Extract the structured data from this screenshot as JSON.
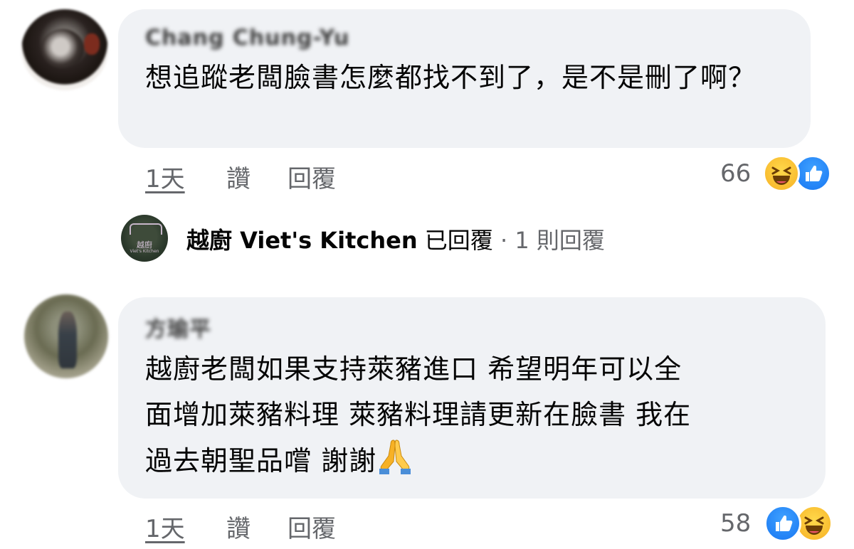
{
  "comments": [
    {
      "author": "Chang Chung-Yu",
      "text": "想追蹤老闆臉書怎麼都找不到了，是不是刪了啊？",
      "time": "1天",
      "like_label": "讚",
      "reply_label": "回覆",
      "reaction_count": "66",
      "reactions": [
        "haha-icon",
        "like-icon"
      ]
    },
    {
      "author": "方瑜平",
      "text_lines": [
        "越廚老闆如果支持萊豬進口 希望明年可以全",
        "面增加萊豬料理 萊豬料理請更新在臉書 我在",
        "過去朝聖品嚐 謝謝"
      ],
      "emoji": "folded-hands-icon",
      "time": "1天",
      "like_label": "讚",
      "reply_label": "回覆",
      "reaction_count": "58",
      "reactions": [
        "like-icon",
        "haha-icon"
      ]
    }
  ],
  "reply_summary": {
    "page_name": "越廚 Viet's Kitchen",
    "replied_label": "已回覆",
    "separator": "·",
    "reply_count": "1 則回覆",
    "avatar_text": "越廚",
    "avatar_subtext": "Viet's Kitchen"
  },
  "colors": {
    "bubble": "#f0f2f5",
    "secondary_text": "#65676b",
    "like_blue": "#1877f2",
    "haha_yellow": "#f7b125"
  }
}
